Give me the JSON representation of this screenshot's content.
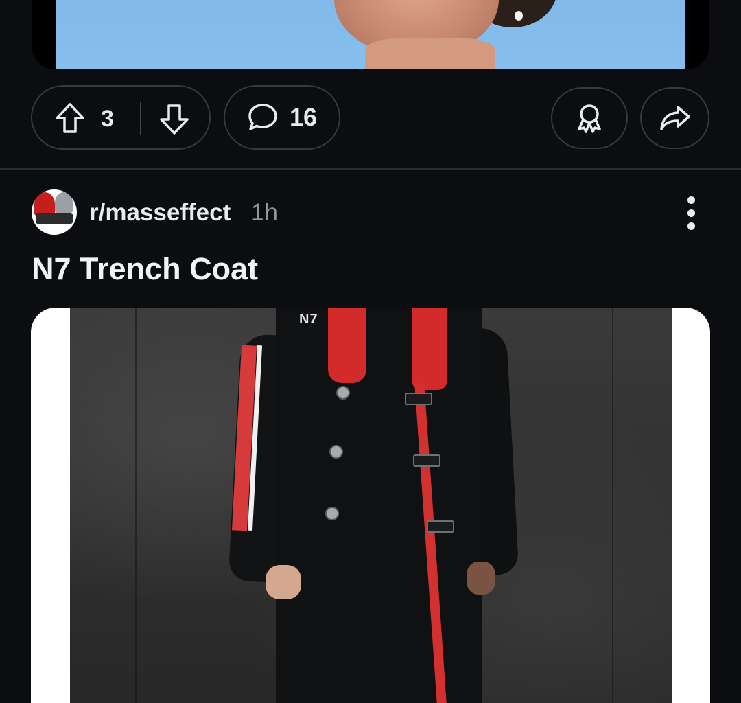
{
  "previous_post": {
    "upvote_count": "3",
    "comment_count": "16"
  },
  "post": {
    "subreddit": "r/masseffect",
    "time_ago": "1h",
    "title": "N7 Trench Coat",
    "image_label": "N7"
  },
  "icons": {
    "upvote": "arrow-up-outline-icon",
    "downvote": "arrow-down-outline-icon",
    "comments": "speech-bubble-icon",
    "award": "award-ribbon-icon",
    "share": "share-arrow-icon",
    "more": "vertical-dots-icon"
  },
  "colors": {
    "background": "#0b0d10",
    "pill_border": "#343a40",
    "text_primary": "#e9ecef",
    "text_secondary": "#8f969c",
    "n7_red": "#d32b2b"
  }
}
